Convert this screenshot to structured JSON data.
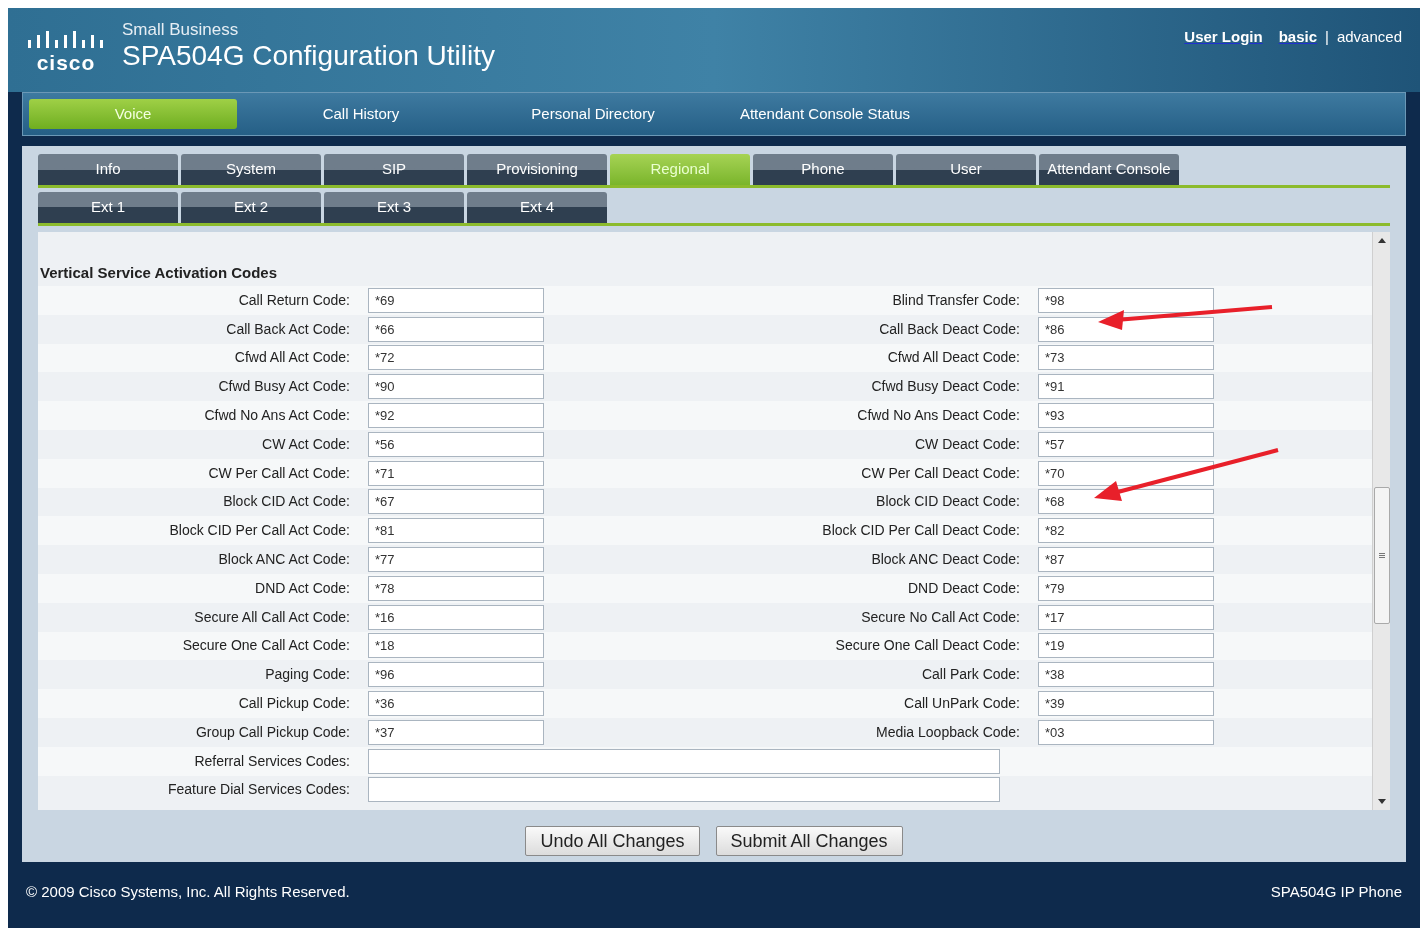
{
  "header": {
    "logo_text": "cisco",
    "subtitle": "Small Business",
    "title": "SPA504G Configuration Utility",
    "user_login": "User Login",
    "modes": [
      {
        "label": "basic",
        "selected": false
      },
      {
        "label": "advanced",
        "selected": true
      }
    ],
    "separator": "|"
  },
  "main_tabs": [
    {
      "label": "Voice",
      "selected": true
    },
    {
      "label": "Call History",
      "selected": false
    },
    {
      "label": "Personal Directory",
      "selected": false
    },
    {
      "label": "Attendant Console Status",
      "selected": false
    }
  ],
  "sub_tabs": [
    {
      "label": "Info",
      "selected": false
    },
    {
      "label": "System",
      "selected": false
    },
    {
      "label": "SIP",
      "selected": false
    },
    {
      "label": "Provisioning",
      "selected": false
    },
    {
      "label": "Regional",
      "selected": true
    },
    {
      "label": "Phone",
      "selected": false
    },
    {
      "label": "User",
      "selected": false
    },
    {
      "label": "Attendant Console",
      "selected": false
    }
  ],
  "ext_tabs": [
    {
      "label": "Ext 1",
      "selected": false
    },
    {
      "label": "Ext 2",
      "selected": false
    },
    {
      "label": "Ext 3",
      "selected": false
    },
    {
      "label": "Ext 4",
      "selected": false
    }
  ],
  "section_title": "Vertical Service Activation Codes",
  "rows": [
    {
      "left": {
        "label": "Call Return Code:",
        "value": "*69"
      },
      "right": {
        "label": "Blind Transfer Code:",
        "value": "*98"
      }
    },
    {
      "left": {
        "label": "Call Back Act Code:",
        "value": "*66"
      },
      "right": {
        "label": "Call Back Deact Code:",
        "value": "*86"
      }
    },
    {
      "left": {
        "label": "Cfwd All Act Code:",
        "value": "*72"
      },
      "right": {
        "label": "Cfwd All Deact Code:",
        "value": "*73"
      }
    },
    {
      "left": {
        "label": "Cfwd Busy Act Code:",
        "value": "*90"
      },
      "right": {
        "label": "Cfwd Busy Deact Code:",
        "value": "*91"
      }
    },
    {
      "left": {
        "label": "Cfwd No Ans Act Code:",
        "value": "*92"
      },
      "right": {
        "label": "Cfwd No Ans Deact Code:",
        "value": "*93"
      }
    },
    {
      "left": {
        "label": "CW Act Code:",
        "value": "*56"
      },
      "right": {
        "label": "CW Deact Code:",
        "value": "*57"
      }
    },
    {
      "left": {
        "label": "CW Per Call Act Code:",
        "value": "*71"
      },
      "right": {
        "label": "CW Per Call Deact Code:",
        "value": "*70"
      }
    },
    {
      "left": {
        "label": "Block CID Act Code:",
        "value": "*67"
      },
      "right": {
        "label": "Block CID Deact Code:",
        "value": "*68"
      }
    },
    {
      "left": {
        "label": "Block CID Per Call Act Code:",
        "value": "*81"
      },
      "right": {
        "label": "Block CID Per Call Deact Code:",
        "value": "*82"
      }
    },
    {
      "left": {
        "label": "Block ANC Act Code:",
        "value": "*77"
      },
      "right": {
        "label": "Block ANC Deact Code:",
        "value": "*87"
      }
    },
    {
      "left": {
        "label": "DND Act Code:",
        "value": "*78"
      },
      "right": {
        "label": "DND Deact Code:",
        "value": "*79"
      }
    },
    {
      "left": {
        "label": "Secure All Call Act Code:",
        "value": "*16"
      },
      "right": {
        "label": "Secure No Call Act Code:",
        "value": "*17"
      }
    },
    {
      "left": {
        "label": "Secure One Call Act Code:",
        "value": "*18"
      },
      "right": {
        "label": "Secure One Call Deact Code:",
        "value": "*19"
      }
    },
    {
      "left": {
        "label": "Paging Code:",
        "value": "*96"
      },
      "right": {
        "label": "Call Park Code:",
        "value": "*38"
      }
    },
    {
      "left": {
        "label": "Call Pickup Code:",
        "value": "*36"
      },
      "right": {
        "label": "Call UnPark Code:",
        "value": "*39"
      }
    },
    {
      "left": {
        "label": "Group Call Pickup Code:",
        "value": "*37"
      },
      "right": {
        "label": "Media Loopback Code:",
        "value": "*03"
      }
    }
  ],
  "wide_rows": [
    {
      "label": "Referral Services Codes:"
    },
    {
      "label": "Feature Dial Services Codes:"
    }
  ],
  "buttons": [
    "Undo All Changes",
    "Submit All Changes"
  ],
  "footer": {
    "copyright": "© 2009 Cisco Systems, Inc. All Rights Reserved.",
    "product": "SPA504G IP Phone"
  }
}
